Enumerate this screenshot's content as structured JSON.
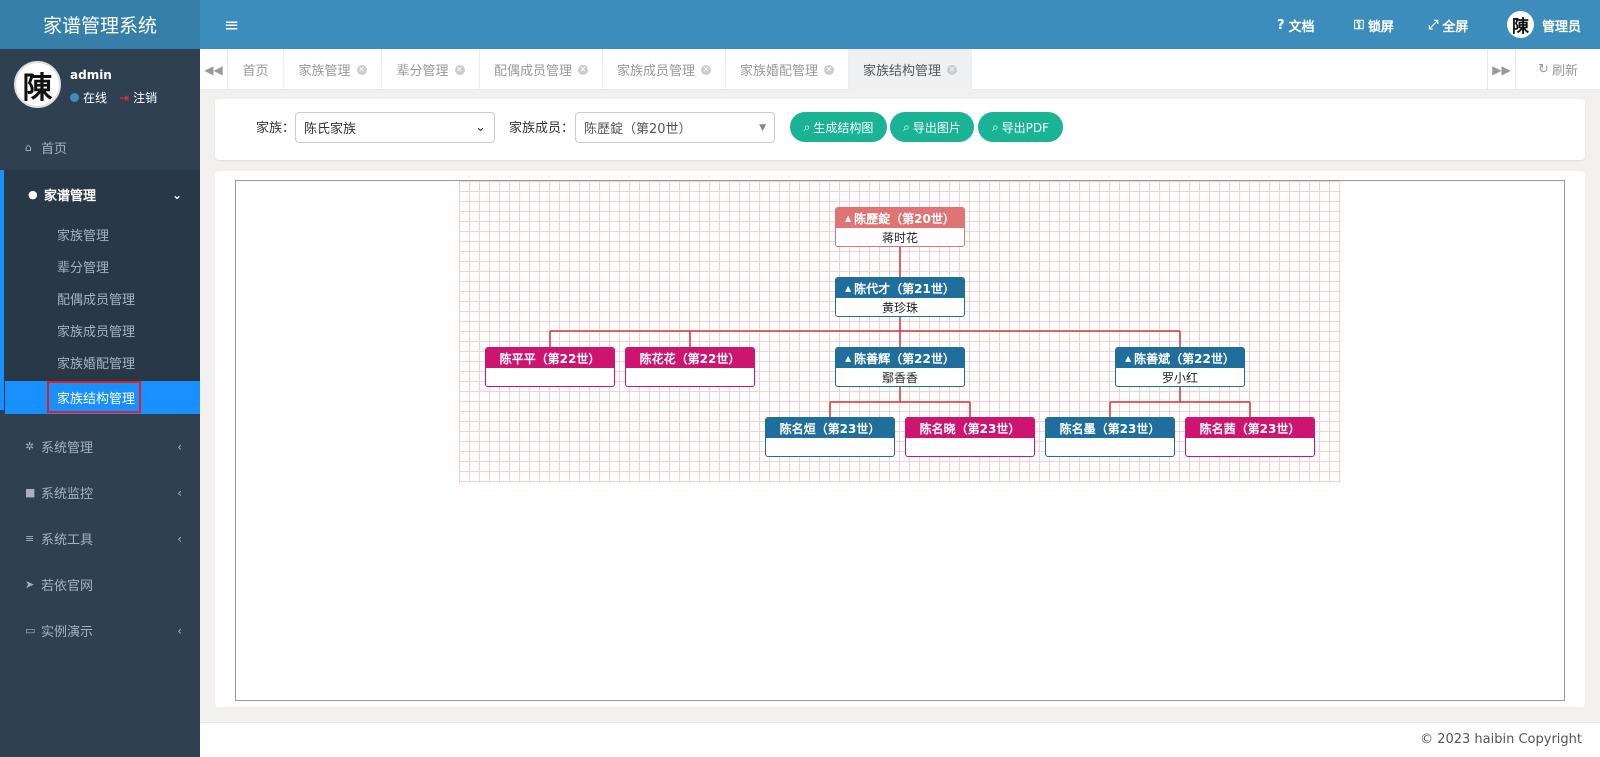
{
  "app": {
    "title": "家谱管理系统"
  },
  "user": {
    "name": "admin",
    "status": "在线",
    "logout": "注销",
    "avatar_char": "陳"
  },
  "sidebar": {
    "home": "首页",
    "genealogy": "家谱管理",
    "sub": [
      "家族管理",
      "辈分管理",
      "配偶成员管理",
      "家族成员管理",
      "家族婚配管理",
      "家族结构管理"
    ],
    "system": "系统管理",
    "monitor": "系统监控",
    "tools": "系统工具",
    "website": "若依官网",
    "demo": "实例演示"
  },
  "topbar": {
    "docs": "文档",
    "lock": "锁屏",
    "fullscreen": "全屏",
    "admin": "管理员",
    "admin_avatar": "陳"
  },
  "tabs": [
    "首页",
    "家族管理",
    "辈分管理",
    "配偶成员管理",
    "家族成员管理",
    "家族婚配管理",
    "家族结构管理"
  ],
  "tabs_refresh": "刷新",
  "filter": {
    "family_label": "家族：",
    "family_value": "陈氏家族",
    "member_label": "家族成员：",
    "member_value": "陈歷錠（第20世）",
    "btn_generate": "生成结构图",
    "btn_export_img": "导出图片",
    "btn_export_pdf": "导出PDF"
  },
  "tree": {
    "n1": {
      "name": "陈歷錠（第20世）",
      "spouse": "蒋时花"
    },
    "n2": {
      "name": "陈代才（第21世）",
      "spouse": "黄珍珠"
    },
    "n3": {
      "name": "陈平平（第22世）",
      "spouse": ""
    },
    "n4": {
      "name": "陈花花（第22世）",
      "spouse": ""
    },
    "n5": {
      "name": "陈善辉（第22世）",
      "spouse": "鄢香香"
    },
    "n6": {
      "name": "陈善斌（第22世）",
      "spouse": "罗小红"
    },
    "n7": {
      "name": "陈名烜（第23世）",
      "spouse": ""
    },
    "n8": {
      "name": "陈名晓（第23世）",
      "spouse": ""
    },
    "n9": {
      "name": "陈名墨（第23世）",
      "spouse": ""
    },
    "n10": {
      "name": "陈名茜（第23世）",
      "spouse": ""
    }
  },
  "colors": {
    "red_node": "#e07474",
    "blue_node": "#1f6e9c",
    "pink_node": "#cc1470",
    "line": "#d33"
  },
  "footer": {
    "copyright": "© 2023 haibin Copyright"
  }
}
